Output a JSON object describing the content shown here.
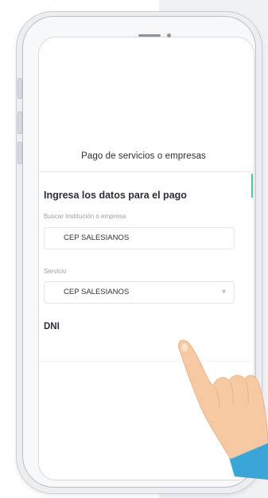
{
  "screen": {
    "header_title": "Pago de servicios o empresas",
    "section_title": "Ingresa los datos para el pago",
    "institution_field": {
      "label": "Buscar Institución o empresa",
      "value": "CEP SALESIANOS"
    },
    "service_field": {
      "label": "Servicio",
      "value": "CEP SALESIANOS",
      "icon": "chevron-down-icon"
    },
    "dni_label": "DNI"
  },
  "colors": {
    "accent": "#4fc39a",
    "skin": "#f6c9a3",
    "sleeve": "#3aa6d8"
  }
}
